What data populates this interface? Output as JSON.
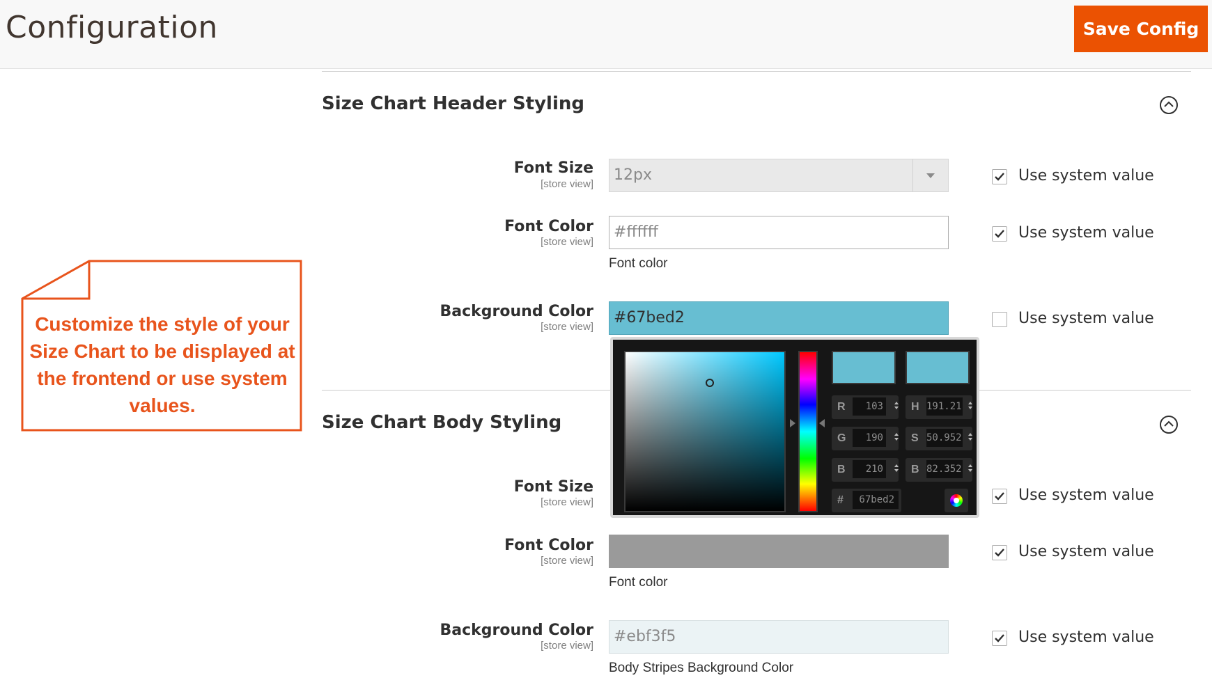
{
  "header": {
    "title": "Configuration",
    "save_label": "Save Config"
  },
  "callout": {
    "text": "Customize the style of your Size Chart to be displayed at the frontend or use system values."
  },
  "sections": {
    "header_styling": {
      "title": "Size Chart Header Styling",
      "font_size": {
        "label": "Font Size",
        "scope": "[store view]",
        "value": "12px",
        "use_system_label": "Use system value",
        "use_system_checked": true
      },
      "font_color": {
        "label": "Font Color",
        "scope": "[store view]",
        "value": "#ffffff",
        "note": "Font color",
        "use_system_label": "Use system value",
        "use_system_checked": true
      },
      "bg_color": {
        "label": "Background Color",
        "scope": "[store view]",
        "value": "#67bed2",
        "use_system_label": "Use system value",
        "use_system_checked": false
      }
    },
    "body_styling": {
      "title": "Size Chart Body Styling",
      "font_size": {
        "label": "Font Size",
        "scope": "[store view]",
        "use_system_label": "Use system value",
        "use_system_checked": true
      },
      "font_color": {
        "label": "Font Color",
        "scope": "[store view]",
        "value": "",
        "note": "Font color",
        "use_system_label": "Use system value",
        "use_system_checked": true
      },
      "bg_color": {
        "label": "Background Color",
        "scope": "[store view]",
        "value": "#ebf3f5",
        "note": "Body Stripes Background Color",
        "use_system_label": "Use system value",
        "use_system_checked": true
      }
    }
  },
  "color_picker": {
    "new_color": "#67bed2",
    "current_color": "#67bed2",
    "fields": {
      "r": {
        "label": "R",
        "value": "103"
      },
      "g": {
        "label": "G",
        "value": "190"
      },
      "b": {
        "label": "B",
        "value": "210"
      },
      "h": {
        "label": "H",
        "value": "191.21"
      },
      "s": {
        "label": "S",
        "value": "50.952"
      },
      "v": {
        "label": "B",
        "value": "82.352"
      },
      "hex": {
        "label": "#",
        "value": "67bed2"
      }
    }
  },
  "colors": {
    "accent": "#eb5202",
    "callout": "#e8541c",
    "body_font_color_swatch": "#9a9a9a"
  }
}
